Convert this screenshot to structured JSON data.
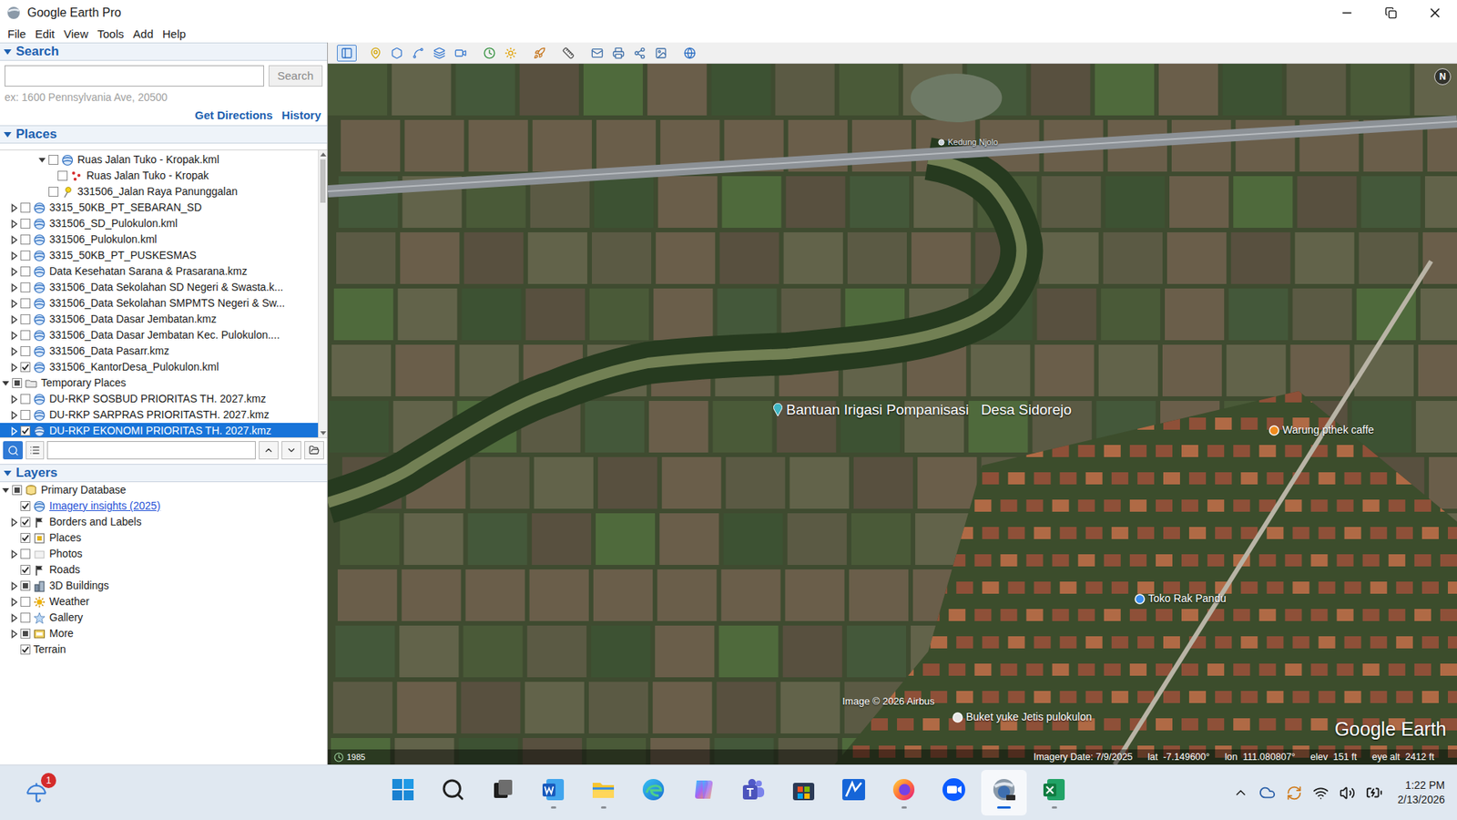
{
  "window": {
    "title": "Google Earth Pro"
  },
  "menu": [
    {
      "label": "File"
    },
    {
      "label": "Edit"
    },
    {
      "label": "View"
    },
    {
      "label": "Tools"
    },
    {
      "label": "Add"
    },
    {
      "label": "Help"
    }
  ],
  "toolbar": [
    {
      "kind": "sidebar",
      "selected": true
    },
    {
      "kind": "placemark",
      "selected": false
    },
    {
      "kind": "polygon",
      "selected": false
    },
    {
      "kind": "path",
      "selected": false
    },
    {
      "kind": "overlay",
      "selected": false
    },
    {
      "kind": "tour",
      "selected": false
    },
    {
      "kind": "history",
      "selected": false
    },
    {
      "kind": "sun",
      "selected": false
    },
    {
      "kind": "planets",
      "selected": false
    },
    {
      "kind": "ruler",
      "selected": false
    },
    {
      "kind": "email",
      "selected": false
    },
    {
      "kind": "print",
      "selected": false
    },
    {
      "kind": "save",
      "selected": false
    },
    {
      "kind": "image",
      "selected": false
    },
    {
      "kind": "maps",
      "selected": false
    }
  ],
  "search": {
    "header": "Search",
    "expanded": true,
    "button": "Search",
    "hint": "ex: 1600 Pennsylvania Ave, 20500",
    "links": [
      "Get Directions",
      "History"
    ]
  },
  "places": {
    "header": "Places",
    "expanded": true,
    "scrollbar": {
      "level": 0.16
    },
    "items": [
      {
        "label": "Ruas Jalan Tuko - Kropak.kml",
        "depth": 3,
        "caret": "expanded",
        "check": "unchecked",
        "icon": "kml",
        "selected": false
      },
      {
        "label": "Ruas Jalan Tuko - Kropak",
        "depth": 4,
        "caret": "none",
        "check": "unchecked",
        "icon": "path",
        "selected": false
      },
      {
        "label": "331506_Jalan Raya Panunggalan",
        "depth": 3,
        "caret": "none",
        "check": "unchecked",
        "icon": "pin",
        "selected": false
      },
      {
        "label": "3315_50KB_PT_SEBARAN_SD",
        "depth": 1,
        "caret": "collapsed",
        "check": "unchecked",
        "icon": "kml",
        "selected": false
      },
      {
        "label": "331506_SD_Pulokulon.kml",
        "depth": 1,
        "caret": "collapsed",
        "check": "unchecked",
        "icon": "kml",
        "selected": false
      },
      {
        "label": "331506_Pulokulon.kml",
        "depth": 1,
        "caret": "collapsed",
        "check": "unchecked",
        "icon": "kml",
        "selected": false
      },
      {
        "label": "3315_50KB_PT_PUSKESMAS",
        "depth": 1,
        "caret": "collapsed",
        "check": "unchecked",
        "icon": "kml",
        "selected": false
      },
      {
        "label": "Data Kesehatan Sarana & Prasarana.kmz",
        "depth": 1,
        "caret": "collapsed",
        "check": "unchecked",
        "icon": "kml",
        "selected": false
      },
      {
        "label": "331506_Data Sekolahan SD Negeri & Swasta.k...",
        "depth": 1,
        "caret": "collapsed",
        "check": "unchecked",
        "icon": "kml",
        "selected": false
      },
      {
        "label": "331506_Data Sekolahan SMPMTS Negeri & Sw...",
        "depth": 1,
        "caret": "collapsed",
        "check": "unchecked",
        "icon": "kml",
        "selected": false
      },
      {
        "label": "331506_Data Dasar Jembatan.kmz",
        "depth": 1,
        "caret": "collapsed",
        "check": "unchecked",
        "icon": "kml",
        "selected": false
      },
      {
        "label": "331506_Data Dasar Jembatan Kec. Pulokulon....",
        "depth": 1,
        "caret": "collapsed",
        "check": "unchecked",
        "icon": "kml",
        "selected": false
      },
      {
        "label": "331506_Data Pasarr.kmz",
        "depth": 1,
        "caret": "collapsed",
        "check": "unchecked",
        "icon": "kml",
        "selected": false
      },
      {
        "label": "331506_KantorDesa_Pulokulon.kml",
        "depth": 1,
        "caret": "collapsed",
        "check": "checked",
        "icon": "kml",
        "selected": false
      },
      {
        "label": "Temporary Places",
        "depth": 0,
        "caret": "expanded",
        "check": "mixed",
        "icon": "folder",
        "selected": false
      },
      {
        "label": "DU-RKP SOSBUD PRIORITAS TH. 2027.kmz",
        "depth": 1,
        "caret": "collapsed",
        "check": "unchecked",
        "icon": "kml",
        "selected": false
      },
      {
        "label": "DU-RKP SARPRAS PRIORITASTH. 2027.kmz",
        "depth": 1,
        "caret": "collapsed",
        "check": "unchecked",
        "icon": "kml",
        "selected": false
      },
      {
        "label": "DU-RKP EKONOMI PRIORITAS TH. 2027.kmz",
        "depth": 1,
        "caret": "collapsed",
        "check": "checked",
        "icon": "kml",
        "selected": true
      }
    ]
  },
  "places_search": {
    "value": "",
    "mode_selected": true
  },
  "layers": {
    "header": "Layers",
    "expanded": true,
    "items": [
      {
        "label": "Primary Database",
        "depth": 0,
        "caret": "expanded",
        "check": "mixed",
        "icon": "database",
        "link": false
      },
      {
        "label": "Imagery insights (2025)",
        "depth": 1,
        "caret": "none",
        "check": "checked",
        "icon": "kml",
        "link": true
      },
      {
        "label": "Borders and Labels",
        "depth": 1,
        "caret": "collapsed",
        "check": "checked",
        "icon": "flag",
        "link": false
      },
      {
        "label": "Places",
        "depth": 1,
        "caret": "none",
        "check": "checked",
        "icon": "square",
        "link": false
      },
      {
        "label": "Photos",
        "depth": 1,
        "caret": "collapsed",
        "check": "unchecked",
        "icon": "photo",
        "link": false
      },
      {
        "label": "Roads",
        "depth": 1,
        "caret": "none",
        "check": "checked",
        "icon": "flag",
        "link": false
      },
      {
        "label": "3D Buildings",
        "depth": 1,
        "caret": "collapsed",
        "check": "mixed",
        "icon": "buildings",
        "link": false
      },
      {
        "label": "Weather",
        "depth": 1,
        "caret": "collapsed",
        "check": "unchecked",
        "icon": "weather",
        "link": false
      },
      {
        "label": "Gallery",
        "depth": 1,
        "caret": "collapsed",
        "check": "unchecked",
        "icon": "gallery",
        "link": false
      },
      {
        "label": "More",
        "depth": 1,
        "caret": "collapsed",
        "check": "mixed",
        "icon": "more",
        "link": false
      },
      {
        "label": "Terrain",
        "depth": 1,
        "caret": "none",
        "check": "checked",
        "icon": "none",
        "link": false
      }
    ]
  },
  "map": {
    "labels": [
      {
        "text": "Kedung Njolo",
        "kind": "small",
        "color": "#c9d1d9"
      },
      {
        "text": "Bantuan Irigasi Pompanisasi   Desa Sidorejo",
        "kind": "large",
        "color": "#3fb6c4"
      },
      {
        "text": "Warung pthek caffe",
        "kind": "normal",
        "color": "#f08c1e"
      },
      {
        "text": "Toko Rak Pandu",
        "kind": "normal",
        "color": "#3b8ef0"
      },
      {
        "text": "Buket yuke Jetis pulokulon",
        "kind": "normal",
        "color": "#e6e6e6"
      }
    ],
    "compass": "N",
    "credit": "Image © 2026 Airbus",
    "logo": "Google Earth",
    "timeline": "1985",
    "status": [
      "Imagery Date: 7/9/2025",
      "lat  -7.149600°",
      "lon  111.080807°",
      "elev  151 ft",
      "eye alt  2412 ft"
    ]
  },
  "taskbar": {
    "badge": "1",
    "time": "1:22 PM",
    "date": "2/13/2026",
    "apps": [
      {
        "kind": "start",
        "running": false,
        "active": false
      },
      {
        "kind": "search",
        "running": false,
        "active": false
      },
      {
        "kind": "taskview",
        "running": false,
        "active": false
      },
      {
        "kind": "word",
        "running": true,
        "active": false
      },
      {
        "kind": "explorer",
        "running": true,
        "active": false
      },
      {
        "kind": "edge",
        "running": false,
        "active": false
      },
      {
        "kind": "copilot",
        "running": false,
        "active": false
      },
      {
        "kind": "teams",
        "running": false,
        "active": false
      },
      {
        "kind": "store",
        "running": false,
        "active": false
      },
      {
        "kind": "pen",
        "running": false,
        "active": false
      },
      {
        "kind": "firefox",
        "running": true,
        "active": false
      },
      {
        "kind": "zoom",
        "running": false,
        "active": false
      },
      {
        "kind": "earth",
        "running": true,
        "active": true
      },
      {
        "kind": "excel",
        "running": true,
        "active": false
      }
    ]
  }
}
